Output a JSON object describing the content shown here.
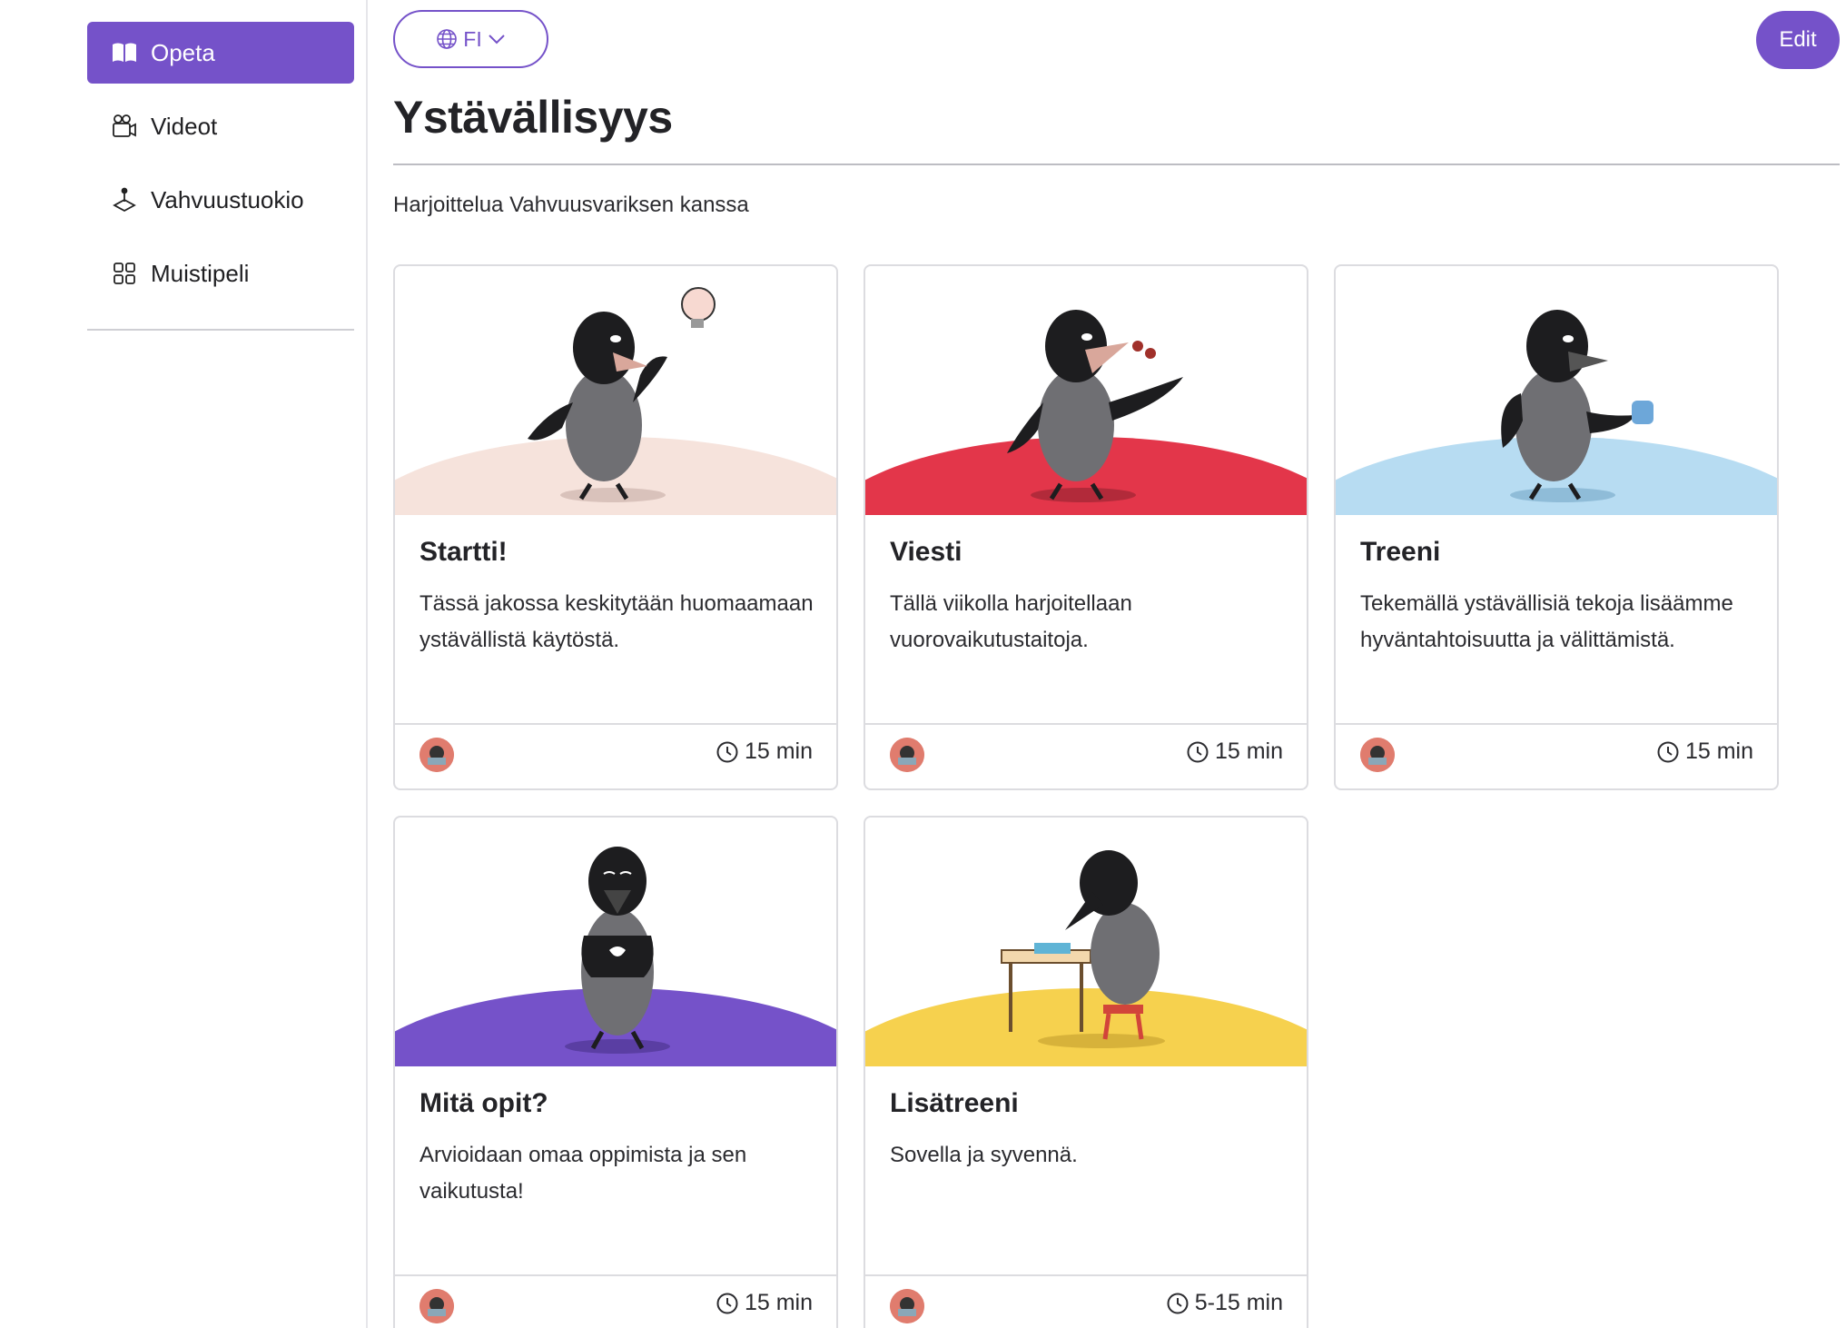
{
  "sidebar": {
    "items": [
      {
        "label": "Opeta",
        "icon": "book-icon",
        "active": true
      },
      {
        "label": "Videot",
        "icon": "video-camera-icon",
        "active": false
      },
      {
        "label": "Vahvuustuokio",
        "icon": "joystick-icon",
        "active": false
      },
      {
        "label": "Muistipeli",
        "icon": "grid-icon",
        "active": false
      }
    ]
  },
  "header": {
    "language": "FI",
    "edit_label": "Edit",
    "title": "Ystävällisyys",
    "subtitle": "Harjoittelua Vahvuusvariksen kanssa"
  },
  "cards": [
    {
      "title": "Startti!",
      "description": "Tässä jakossa keskitytään huomaamaan ystävällistä käytöstä.",
      "duration": "15 min",
      "color": "#f6e3dc"
    },
    {
      "title": "Viesti",
      "description": "Tällä viikolla harjoitellaan vuorovaikutustaitoja.",
      "duration": "15 min",
      "color": "#e3364a"
    },
    {
      "title": "Treeni",
      "description": "Tekemällä ystävällisiä tekoja lisäämme hyväntahtoisuutta ja välittämistä.",
      "duration": "15 min",
      "color": "#b7dcf2"
    },
    {
      "title": "Mitä opit?",
      "description": "Arvioidaan omaa oppimista ja sen vaikutusta!",
      "duration": "15 min",
      "color": "#7552c9"
    },
    {
      "title": "Lisätreeni",
      "description": "Sovella ja syvennä.",
      "duration": "5-15 min",
      "color": "#f6d14e"
    }
  ],
  "colors": {
    "accent": "#7552c9",
    "border": "#dcdce0",
    "avatar": "#e07c6e"
  }
}
